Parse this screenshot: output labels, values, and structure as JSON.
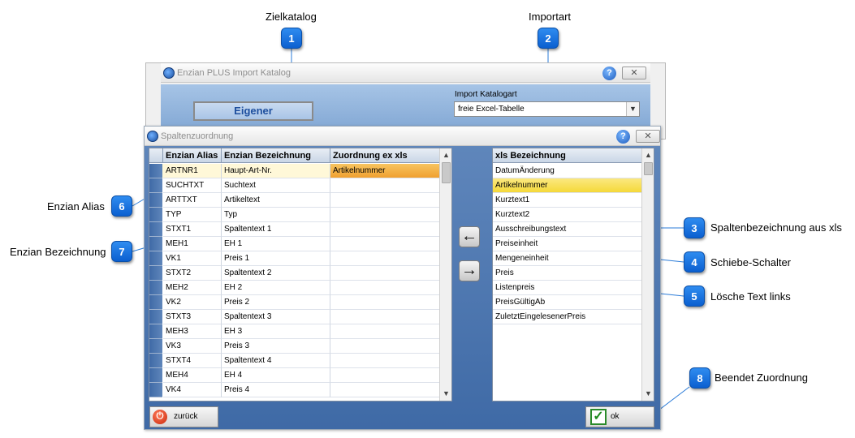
{
  "callouts": [
    {
      "num": "1",
      "label": "Zielkatalog"
    },
    {
      "num": "2",
      "label": "Importart"
    },
    {
      "num": "3",
      "label": "Spaltenbezeichnung aus xls"
    },
    {
      "num": "4",
      "label": "Schiebe-Schalter"
    },
    {
      "num": "5",
      "label": "Lösche Text links"
    },
    {
      "num": "6",
      "label": "Enzian Alias"
    },
    {
      "num": "7",
      "label": "Enzian Bezeichnung"
    },
    {
      "num": "8",
      "label": "Beendet Zuordnung"
    }
  ],
  "top_dialog": {
    "title": "Enzian PLUS Import Katalog",
    "help": "?",
    "close": "✕",
    "target_catalog": "Eigener",
    "import_label": "Import Katalogart",
    "import_value": "freie Excel-Tabelle"
  },
  "main_dialog": {
    "title": "Spaltenzuordnung",
    "help": "?",
    "close": "✕",
    "left_table": {
      "headers": [
        "Enzian Alias",
        "Enzian Bezeichnung",
        "Zuordnung ex xls"
      ],
      "rows": [
        [
          "ARTNR1",
          "Haupt-Art-Nr.",
          "Artikelnummer"
        ],
        [
          "SUCHTXT",
          "Suchtext",
          ""
        ],
        [
          "ARTTXT",
          "Artikeltext",
          ""
        ],
        [
          "TYP",
          "Typ",
          ""
        ],
        [
          "STXT1",
          "Spaltentext 1",
          ""
        ],
        [
          "MEH1",
          "EH 1",
          ""
        ],
        [
          "VK1",
          "Preis 1",
          ""
        ],
        [
          "STXT2",
          "Spaltentext 2",
          ""
        ],
        [
          "MEH2",
          "EH 2",
          ""
        ],
        [
          "VK2",
          "Preis 2",
          ""
        ],
        [
          "STXT3",
          "Spaltentext 3",
          ""
        ],
        [
          "MEH3",
          "EH 3",
          ""
        ],
        [
          "VK3",
          "Preis 3",
          ""
        ],
        [
          "STXT4",
          "Spaltentext 4",
          ""
        ],
        [
          "MEH4",
          "EH 4",
          ""
        ],
        [
          "VK4",
          "Preis 4",
          ""
        ]
      ]
    },
    "right_table": {
      "header": "xls Bezeichnung",
      "rows": [
        "DatumÄnderung",
        "Artikelnummer",
        "Kurztext1",
        "Kurztext2",
        "Ausschreibungstext",
        "Preiseinheit",
        "Mengeneinheit",
        "Preis",
        "Listenpreis",
        "PreisGültigAb",
        "ZuletztEingelesenerPreis"
      ],
      "selected_index": 1
    },
    "move_left_symbol": "←",
    "move_right_symbol": "→",
    "back_label": "zurück",
    "ok_label": "ok"
  },
  "colors": {
    "callout_blue": "#1a73e8",
    "callout_line": "#2a7bd8",
    "highlight_yellow": "#f5d93a",
    "assigned_orange": "#f0a030",
    "arrow_yellow": "#ffee22"
  }
}
